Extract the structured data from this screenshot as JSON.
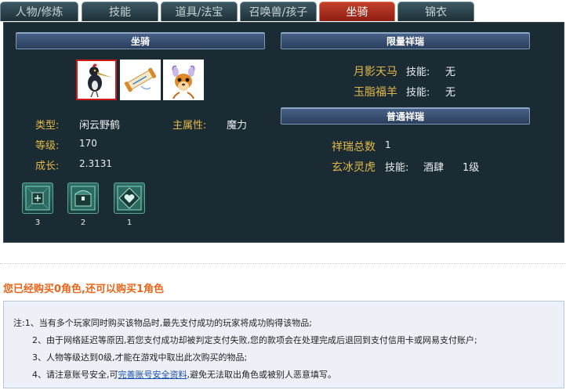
{
  "tabs": [
    {
      "label": "人物/修炼"
    },
    {
      "label": "技能"
    },
    {
      "label": "道具/法宝"
    },
    {
      "label": "召唤兽/孩子"
    },
    {
      "label": "坐骑"
    },
    {
      "label": "锦衣"
    }
  ],
  "active_tab": 4,
  "mount": {
    "section_title": "坐骑",
    "slots": [
      {
        "icon": "crane-mount-icon",
        "selected": true
      },
      {
        "icon": "scroll-mount-icon",
        "selected": false
      },
      {
        "icon": "deer-mount-icon",
        "selected": false
      }
    ],
    "type_label": "类型:",
    "type_value": "闲云野鹤",
    "attr_label": "主属性:",
    "attr_value": "魔力",
    "level_label": "等级:",
    "level_value": "170",
    "growth_label": "成长:",
    "growth_value": "2.3131",
    "skills": [
      {
        "icon": "skill-rune-icon",
        "count": "3"
      },
      {
        "icon": "skill-chest-icon",
        "count": "2"
      },
      {
        "icon": "skill-heart-icon",
        "count": "1"
      }
    ]
  },
  "limited": {
    "section_title": "限量祥瑞",
    "items": [
      {
        "name": "月影天马",
        "skill_label": "技能:",
        "skill_value": "无"
      },
      {
        "name": "玉脂福羊",
        "skill_label": "技能:",
        "skill_value": "无"
      }
    ]
  },
  "normal": {
    "section_title": "普通祥瑞",
    "total_label": "祥瑞总数",
    "total_value": "1",
    "item_name": "玄冰灵虎",
    "item_skill_label": "技能:",
    "item_skill_value": "酒肆",
    "item_skill_level": "1级"
  },
  "notice": "您已经购买0角色,还可以购买1角色",
  "notes": {
    "line1": "注:1、当有多个玩家同时购买该物品时,最先支付成功的玩家将成功购得该物品;",
    "line2": "2、由于网络延迟等原因,若您支付成功却被判定支付失败,您的款项会在处理完成后退回到支付信用卡或网易支付账户;",
    "line3": "3、人物等级达到0级,才能在游戏中取出此次购买的物品;",
    "line4_pre": "4、请注意账号安全,可",
    "line4_link": "完善账号安全资料",
    "line4_post": ",避免无法取出角色或被别人恶意填写。"
  },
  "colors": {
    "panel_bg": "#1b2b33",
    "label_gold": "#e2b84a",
    "active_tab_red": "#b3321f",
    "notice_orange": "#e8651a"
  }
}
